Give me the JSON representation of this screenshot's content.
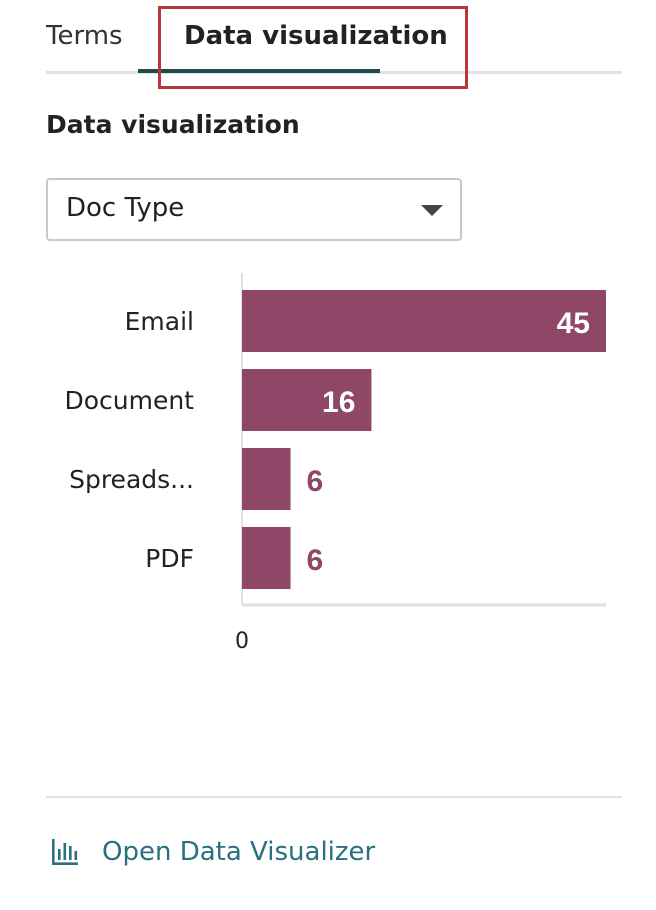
{
  "tabs": [
    {
      "label": "Terms",
      "active": false
    },
    {
      "label": "Data visualization",
      "active": true
    }
  ],
  "section": {
    "title": "Data visualization"
  },
  "dropdown": {
    "selected": "Doc Type"
  },
  "chart_data": {
    "type": "bar",
    "orientation": "horizontal",
    "categories": [
      "Email",
      "Document",
      "Spreads...",
      "PDF"
    ],
    "values": [
      45,
      16,
      6,
      6
    ],
    "xlim": [
      0,
      45
    ],
    "x_tick_labels": [
      "0"
    ],
    "bar_color": "#8e4766",
    "label_inside_color": "#ffffff",
    "label_outside_color": "#8e4766"
  },
  "footer": {
    "link_label": "Open Data Visualizer",
    "icon": "bar-chart-icon",
    "color": "#2a7080"
  },
  "colors": {
    "tab_underline": "#1f4a4a",
    "highlight_border": "#b8353a"
  }
}
